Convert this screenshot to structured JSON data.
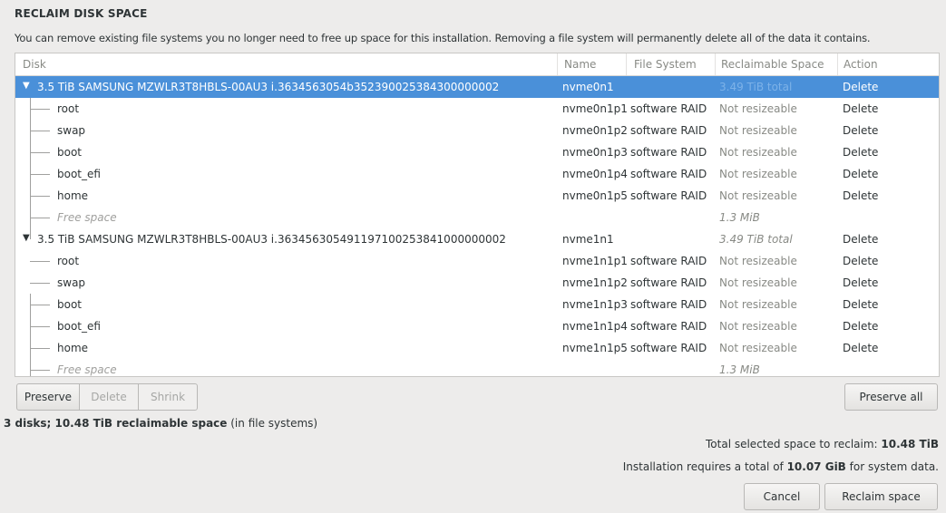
{
  "title": "RECLAIM DISK SPACE",
  "description": "You can remove existing file systems you no longer need to free up space for this installation.  Removing a file system will permanently delete all of the data it contains.",
  "columns": {
    "disk": "Disk",
    "name": "Name",
    "filesystem": "File System",
    "reclaimable": "Reclaimable Space",
    "action": "Action"
  },
  "disks": [
    {
      "label": "3.5 TiB SAMSUNG MZWLR3T8HBLS-00AU3 i.3634563054b352390025384300000002",
      "name": "nvme0n1",
      "reclaimable": "3.49 TiB total",
      "action": "Delete",
      "partitions": [
        {
          "label": "root",
          "name": "nvme0n1p1",
          "fs": "software RAID",
          "reclaimable": "Not resizeable",
          "action": "Delete"
        },
        {
          "label": "swap",
          "name": "nvme0n1p2",
          "fs": "software RAID",
          "reclaimable": "Not resizeable",
          "action": "Delete"
        },
        {
          "label": "boot",
          "name": "nvme0n1p3",
          "fs": "software RAID",
          "reclaimable": "Not resizeable",
          "action": "Delete"
        },
        {
          "label": "boot_efi",
          "name": "nvme0n1p4",
          "fs": "software RAID",
          "reclaimable": "Not resizeable",
          "action": "Delete"
        },
        {
          "label": "home",
          "name": "nvme0n1p5",
          "fs": "software RAID",
          "reclaimable": "Not resizeable",
          "action": "Delete"
        },
        {
          "label": "Free space",
          "name": "",
          "fs": "",
          "reclaimable": "1.3 MiB",
          "action": ""
        }
      ]
    },
    {
      "label": "3.5 TiB SAMSUNG MZWLR3T8HBLS-00AU3 i.363456305491197100253841000000002",
      "name": "nvme1n1",
      "reclaimable": "3.49 TiB total",
      "action": "Delete",
      "partitions": [
        {
          "label": "root",
          "name": "nvme1n1p1",
          "fs": "software RAID",
          "reclaimable": "Not resizeable",
          "action": "Delete"
        },
        {
          "label": "swap",
          "name": "nvme1n1p2",
          "fs": "software RAID",
          "reclaimable": "Not resizeable",
          "action": "Delete"
        },
        {
          "label": "boot",
          "name": "nvme1n1p3",
          "fs": "software RAID",
          "reclaimable": "Not resizeable",
          "action": "Delete"
        },
        {
          "label": "boot_efi",
          "name": "nvme1n1p4",
          "fs": "software RAID",
          "reclaimable": "Not resizeable",
          "action": "Delete"
        },
        {
          "label": "home",
          "name": "nvme1n1p5",
          "fs": "software RAID",
          "reclaimable": "Not resizeable",
          "action": "Delete"
        },
        {
          "label": "Free space",
          "name": "",
          "fs": "",
          "reclaimable": "1.3 MiB",
          "action": ""
        }
      ]
    }
  ],
  "buttons": {
    "preserve": "Preserve",
    "delete": "Delete",
    "shrink": "Shrink",
    "preserve_all": "Preserve all",
    "cancel": "Cancel",
    "reclaim": "Reclaim space"
  },
  "summary": {
    "bold": "3 disks; 10.48 TiB reclaimable space",
    "rest": " (in file systems)"
  },
  "total": {
    "prefix": "Total selected space to reclaim: ",
    "value": "10.48 TiB"
  },
  "requires": {
    "prefix": "Installation requires a total of ",
    "value": "10.07 GiB",
    "suffix": " for system data."
  },
  "colors": {
    "selection": "#4a90d9",
    "background": "#edeceb"
  }
}
